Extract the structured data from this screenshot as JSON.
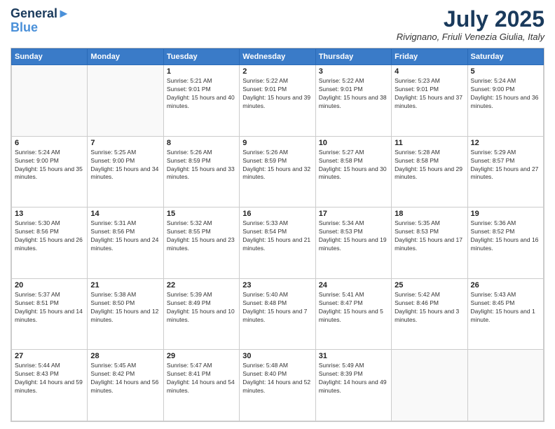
{
  "header": {
    "logo_line1": "General",
    "logo_line2": "Blue",
    "month_year": "July 2025",
    "location": "Rivignano, Friuli Venezia Giulia, Italy"
  },
  "days_of_week": [
    "Sunday",
    "Monday",
    "Tuesday",
    "Wednesday",
    "Thursday",
    "Friday",
    "Saturday"
  ],
  "weeks": [
    [
      {
        "day": "",
        "sunrise": "",
        "sunset": "",
        "daylight": ""
      },
      {
        "day": "",
        "sunrise": "",
        "sunset": "",
        "daylight": ""
      },
      {
        "day": "1",
        "sunrise": "Sunrise: 5:21 AM",
        "sunset": "Sunset: 9:01 PM",
        "daylight": "Daylight: 15 hours and 40 minutes."
      },
      {
        "day": "2",
        "sunrise": "Sunrise: 5:22 AM",
        "sunset": "Sunset: 9:01 PM",
        "daylight": "Daylight: 15 hours and 39 minutes."
      },
      {
        "day": "3",
        "sunrise": "Sunrise: 5:22 AM",
        "sunset": "Sunset: 9:01 PM",
        "daylight": "Daylight: 15 hours and 38 minutes."
      },
      {
        "day": "4",
        "sunrise": "Sunrise: 5:23 AM",
        "sunset": "Sunset: 9:01 PM",
        "daylight": "Daylight: 15 hours and 37 minutes."
      },
      {
        "day": "5",
        "sunrise": "Sunrise: 5:24 AM",
        "sunset": "Sunset: 9:00 PM",
        "daylight": "Daylight: 15 hours and 36 minutes."
      }
    ],
    [
      {
        "day": "6",
        "sunrise": "Sunrise: 5:24 AM",
        "sunset": "Sunset: 9:00 PM",
        "daylight": "Daylight: 15 hours and 35 minutes."
      },
      {
        "day": "7",
        "sunrise": "Sunrise: 5:25 AM",
        "sunset": "Sunset: 9:00 PM",
        "daylight": "Daylight: 15 hours and 34 minutes."
      },
      {
        "day": "8",
        "sunrise": "Sunrise: 5:26 AM",
        "sunset": "Sunset: 8:59 PM",
        "daylight": "Daylight: 15 hours and 33 minutes."
      },
      {
        "day": "9",
        "sunrise": "Sunrise: 5:26 AM",
        "sunset": "Sunset: 8:59 PM",
        "daylight": "Daylight: 15 hours and 32 minutes."
      },
      {
        "day": "10",
        "sunrise": "Sunrise: 5:27 AM",
        "sunset": "Sunset: 8:58 PM",
        "daylight": "Daylight: 15 hours and 30 minutes."
      },
      {
        "day": "11",
        "sunrise": "Sunrise: 5:28 AM",
        "sunset": "Sunset: 8:58 PM",
        "daylight": "Daylight: 15 hours and 29 minutes."
      },
      {
        "day": "12",
        "sunrise": "Sunrise: 5:29 AM",
        "sunset": "Sunset: 8:57 PM",
        "daylight": "Daylight: 15 hours and 27 minutes."
      }
    ],
    [
      {
        "day": "13",
        "sunrise": "Sunrise: 5:30 AM",
        "sunset": "Sunset: 8:56 PM",
        "daylight": "Daylight: 15 hours and 26 minutes."
      },
      {
        "day": "14",
        "sunrise": "Sunrise: 5:31 AM",
        "sunset": "Sunset: 8:56 PM",
        "daylight": "Daylight: 15 hours and 24 minutes."
      },
      {
        "day": "15",
        "sunrise": "Sunrise: 5:32 AM",
        "sunset": "Sunset: 8:55 PM",
        "daylight": "Daylight: 15 hours and 23 minutes."
      },
      {
        "day": "16",
        "sunrise": "Sunrise: 5:33 AM",
        "sunset": "Sunset: 8:54 PM",
        "daylight": "Daylight: 15 hours and 21 minutes."
      },
      {
        "day": "17",
        "sunrise": "Sunrise: 5:34 AM",
        "sunset": "Sunset: 8:53 PM",
        "daylight": "Daylight: 15 hours and 19 minutes."
      },
      {
        "day": "18",
        "sunrise": "Sunrise: 5:35 AM",
        "sunset": "Sunset: 8:53 PM",
        "daylight": "Daylight: 15 hours and 17 minutes."
      },
      {
        "day": "19",
        "sunrise": "Sunrise: 5:36 AM",
        "sunset": "Sunset: 8:52 PM",
        "daylight": "Daylight: 15 hours and 16 minutes."
      }
    ],
    [
      {
        "day": "20",
        "sunrise": "Sunrise: 5:37 AM",
        "sunset": "Sunset: 8:51 PM",
        "daylight": "Daylight: 15 hours and 14 minutes."
      },
      {
        "day": "21",
        "sunrise": "Sunrise: 5:38 AM",
        "sunset": "Sunset: 8:50 PM",
        "daylight": "Daylight: 15 hours and 12 minutes."
      },
      {
        "day": "22",
        "sunrise": "Sunrise: 5:39 AM",
        "sunset": "Sunset: 8:49 PM",
        "daylight": "Daylight: 15 hours and 10 minutes."
      },
      {
        "day": "23",
        "sunrise": "Sunrise: 5:40 AM",
        "sunset": "Sunset: 8:48 PM",
        "daylight": "Daylight: 15 hours and 7 minutes."
      },
      {
        "day": "24",
        "sunrise": "Sunrise: 5:41 AM",
        "sunset": "Sunset: 8:47 PM",
        "daylight": "Daylight: 15 hours and 5 minutes."
      },
      {
        "day": "25",
        "sunrise": "Sunrise: 5:42 AM",
        "sunset": "Sunset: 8:46 PM",
        "daylight": "Daylight: 15 hours and 3 minutes."
      },
      {
        "day": "26",
        "sunrise": "Sunrise: 5:43 AM",
        "sunset": "Sunset: 8:45 PM",
        "daylight": "Daylight: 15 hours and 1 minute."
      }
    ],
    [
      {
        "day": "27",
        "sunrise": "Sunrise: 5:44 AM",
        "sunset": "Sunset: 8:43 PM",
        "daylight": "Daylight: 14 hours and 59 minutes."
      },
      {
        "day": "28",
        "sunrise": "Sunrise: 5:45 AM",
        "sunset": "Sunset: 8:42 PM",
        "daylight": "Daylight: 14 hours and 56 minutes."
      },
      {
        "day": "29",
        "sunrise": "Sunrise: 5:47 AM",
        "sunset": "Sunset: 8:41 PM",
        "daylight": "Daylight: 14 hours and 54 minutes."
      },
      {
        "day": "30",
        "sunrise": "Sunrise: 5:48 AM",
        "sunset": "Sunset: 8:40 PM",
        "daylight": "Daylight: 14 hours and 52 minutes."
      },
      {
        "day": "31",
        "sunrise": "Sunrise: 5:49 AM",
        "sunset": "Sunset: 8:39 PM",
        "daylight": "Daylight: 14 hours and 49 minutes."
      },
      {
        "day": "",
        "sunrise": "",
        "sunset": "",
        "daylight": ""
      },
      {
        "day": "",
        "sunrise": "",
        "sunset": "",
        "daylight": ""
      }
    ]
  ]
}
